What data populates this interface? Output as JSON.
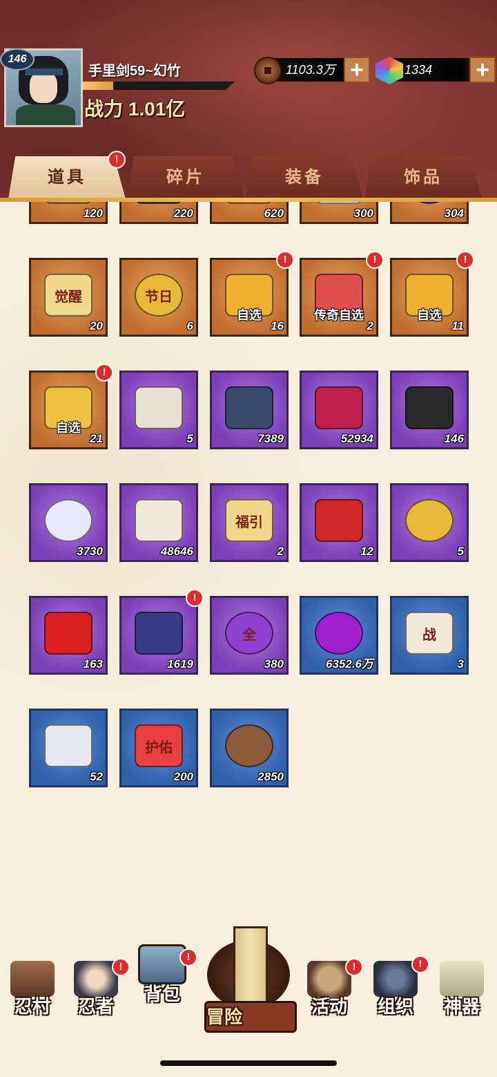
{
  "player": {
    "level": "146",
    "name": "手里剑59~幻竹",
    "xp_fraction": 0.2,
    "power": "战力 1.01亿"
  },
  "resources": {
    "coins": "1103.3万",
    "gems": "1334",
    "plus": "+"
  },
  "tabs": [
    {
      "label": "道具",
      "active": true,
      "badge": "!"
    },
    {
      "label": "碎片",
      "active": false
    },
    {
      "label": "装备",
      "active": false
    },
    {
      "label": "饰品",
      "active": false
    }
  ],
  "items": [
    {
      "count": "120",
      "rarity": "orange",
      "icon": "rope-icon"
    },
    {
      "count": "220",
      "rarity": "orange",
      "icon": "gourd-icon"
    },
    {
      "count": "620",
      "rarity": "orange",
      "icon": "pouch-icon"
    },
    {
      "count": "300",
      "rarity": "orange",
      "icon": "bandage-icon"
    },
    {
      "count": "304",
      "rarity": "orange",
      "icon": "blue-flame-orb-icon"
    },
    {
      "count": "20",
      "rarity": "orange",
      "icon": "awaken-ticket-icon",
      "text": "觉醒"
    },
    {
      "count": "6",
      "rarity": "orange",
      "icon": "festival-coin-icon",
      "text": "节日"
    },
    {
      "count": "16",
      "rarity": "orange",
      "icon": "select-chest-icon",
      "label": "自选",
      "badge": "!"
    },
    {
      "count": "2",
      "rarity": "orange",
      "icon": "legend-chest-icon",
      "label": "传奇自选",
      "badge": "!"
    },
    {
      "count": "11",
      "rarity": "orange",
      "icon": "select-chest-icon",
      "label": "自选",
      "badge": "!"
    },
    {
      "count": "21",
      "rarity": "orange",
      "icon": "gold-chest-icon",
      "label": "自选",
      "badge": "!"
    },
    {
      "count": "5",
      "rarity": "purple",
      "icon": "scroll-icon"
    },
    {
      "count": "7389",
      "rarity": "purple",
      "icon": "upgrade-book-icon"
    },
    {
      "count": "52934",
      "rarity": "purple",
      "icon": "potion-jar-icon"
    },
    {
      "count": "146",
      "rarity": "purple",
      "icon": "ore-icon"
    },
    {
      "count": "3730",
      "rarity": "purple",
      "icon": "yin-yang-icon"
    },
    {
      "count": "48646",
      "rarity": "purple",
      "icon": "paper-stack-icon"
    },
    {
      "count": "2",
      "rarity": "purple",
      "icon": "fortune-ticket-icon",
      "text": "福引"
    },
    {
      "count": "12",
      "rarity": "purple",
      "icon": "medkit-icon"
    },
    {
      "count": "5",
      "rarity": "purple",
      "icon": "torii-coin-icon"
    },
    {
      "count": "163",
      "rarity": "purple",
      "icon": "red-crystal-icon"
    },
    {
      "count": "1619",
      "rarity": "purple",
      "icon": "purple-box-icon",
      "badge": "!"
    },
    {
      "count": "380",
      "rarity": "purple",
      "icon": "all-orb-icon",
      "text": "全"
    },
    {
      "count": "6352.6万",
      "rarity": "blue",
      "icon": "purple-orb-icon"
    },
    {
      "count": "3",
      "rarity": "blue",
      "icon": "battle-scroll-icon",
      "text": "战"
    },
    {
      "count": "52",
      "rarity": "blue",
      "icon": "cloth-icon"
    },
    {
      "count": "200",
      "rarity": "blue",
      "icon": "amulet-icon",
      "text": "护佑"
    },
    {
      "count": "2850",
      "rarity": "blue",
      "icon": "swirl-coin-icon"
    }
  ],
  "nav": [
    {
      "label": "忍村",
      "icon": "village-gate-icon"
    },
    {
      "label": "忍者",
      "icon": "ninja-icon",
      "badge": "!"
    },
    {
      "label": "背包",
      "icon": "backpack-icon",
      "badge": "!"
    },
    {
      "label": "冒险",
      "icon": "adventure-scroll-icon"
    },
    {
      "label": "活动",
      "icon": "kunai-drum-icon",
      "badge": "!"
    },
    {
      "label": "组织",
      "icon": "organization-icon",
      "badge": "!"
    },
    {
      "label": "神器",
      "icon": "artifact-book-icon"
    }
  ],
  "colors": {
    "orange": "#c06d2e",
    "purple": "#7a3eb6",
    "blue": "#2e5fa8",
    "badge": "#e02b2b"
  }
}
